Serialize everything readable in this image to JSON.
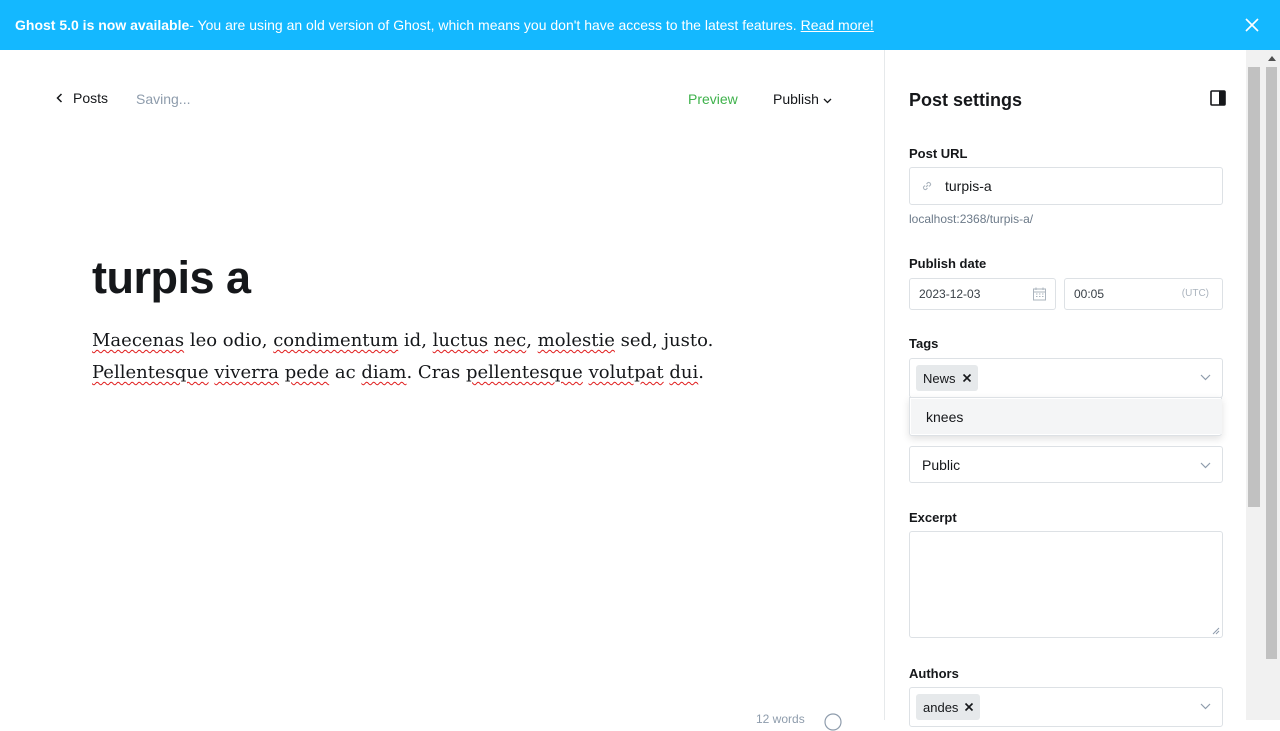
{
  "banner": {
    "bold": "Ghost 5.0 is now available",
    "message": " - You are using an old version of Ghost, which means you don't have access to the latest features.",
    "link": "Read more!"
  },
  "header": {
    "back_label": "Posts",
    "status": "Saving...",
    "preview_label": "Preview",
    "publish_label": "Publish"
  },
  "post": {
    "title": "turpis a",
    "body": [
      {
        "w": "Maecenas",
        "s": true
      },
      {
        "w": " leo odio, "
      },
      {
        "w": "condimentum",
        "s": true
      },
      {
        "w": " id, "
      },
      {
        "w": "luctus",
        "s": true
      },
      {
        "w": " "
      },
      {
        "w": "nec",
        "s": true
      },
      {
        "w": ", "
      },
      {
        "w": "molestie",
        "s": true
      },
      {
        "w": " sed, justo. "
      },
      {
        "w": "Pellentesque",
        "s": true
      },
      {
        "w": " "
      },
      {
        "w": "viverra",
        "s": true
      },
      {
        "w": " "
      },
      {
        "w": "pede",
        "s": true
      },
      {
        "w": " ac "
      },
      {
        "w": "diam",
        "s": true
      },
      {
        "w": ". Cras "
      },
      {
        "w": "pellentesque",
        "s": true
      },
      {
        "w": " "
      },
      {
        "w": "volutpat",
        "s": true
      },
      {
        "w": " "
      },
      {
        "w": "dui",
        "s": true
      },
      {
        "w": "."
      }
    ],
    "word_count": "12 words"
  },
  "settings": {
    "title": "Post settings",
    "post_url_label": "Post URL",
    "post_url_value": "turpis-a",
    "post_url_help": "localhost:2368/turpis-a/",
    "publish_date_label": "Publish date",
    "date_value": "2023-12-03",
    "time_value": "00:05",
    "timezone": "(UTC)",
    "tags_label": "Tags",
    "tags": [
      "News"
    ],
    "tag_dropdown_option": "knees",
    "visibility_value": "Public",
    "excerpt_label": "Excerpt",
    "excerpt_value": "",
    "authors_label": "Authors",
    "authors": [
      "andes"
    ]
  },
  "colors": {
    "banner_bg": "#14b8ff",
    "preview_green": "#3eb24b",
    "spellcheck_red": "#e01b1b"
  }
}
